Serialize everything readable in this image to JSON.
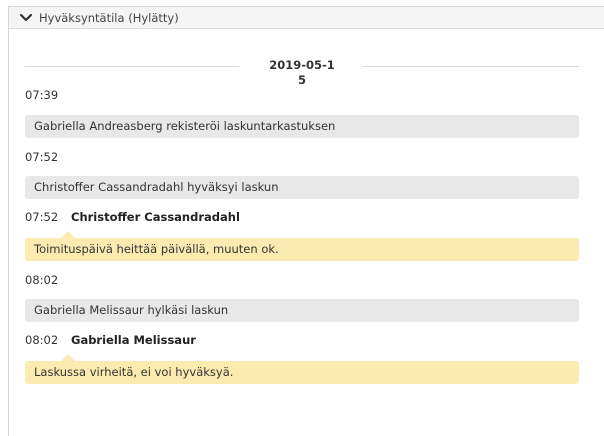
{
  "section": {
    "title": "Hyväksyntätila (Hylätty)",
    "expanded_icon": "chevron-down-icon"
  },
  "timeline": {
    "date": "2019-05-15",
    "entries": [
      {
        "time": "07:39",
        "type": "event",
        "text": "Gabriella Andreasberg rekisteröi laskuntarkastuksen"
      },
      {
        "time": "07:52",
        "type": "event",
        "text": "Christoffer Cassandradahl hyväksyi laskun"
      },
      {
        "time": "07:52",
        "type": "comment",
        "author": "Christoffer Cassandradahl",
        "text": "Toimituspäivä heittää päivällä, muuten ok."
      },
      {
        "time": "08:02",
        "type": "event",
        "text": "Gabriella Melissaur hylkäsi laskun"
      },
      {
        "time": "08:02",
        "type": "comment",
        "author": "Gabriella Melissaur",
        "text": "Laskussa virheitä, ei voi hyväksyä."
      }
    ]
  },
  "colors": {
    "event_bg": "#e8e8e8",
    "comment_bg": "#fcebb0",
    "header_bg": "#f5f5f5"
  }
}
